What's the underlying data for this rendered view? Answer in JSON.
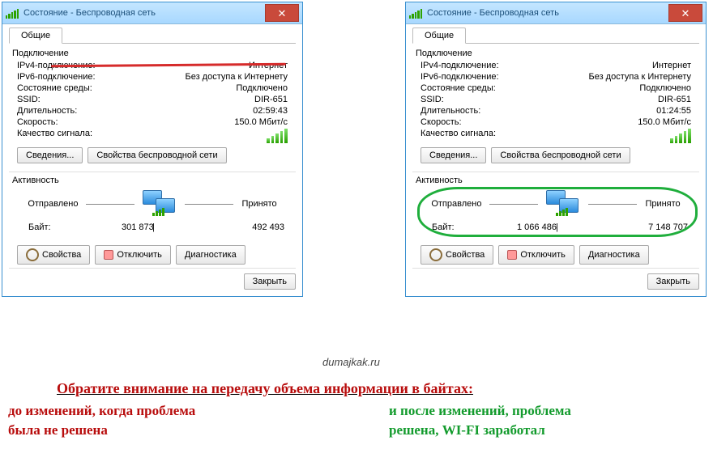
{
  "left": {
    "title": "Состояние - Беспроводная сеть",
    "tab": "Общие",
    "conn_hd": "Подключение",
    "rows": {
      "ipv4_k": "IPv4-подключение:",
      "ipv4_v": "Интернет",
      "ipv6_k": "IPv6-подключение:",
      "ipv6_v": "Без доступа к Интернету",
      "env_k": "Состояние среды:",
      "env_v": "Подключено",
      "ssid_k": "SSID:",
      "ssid_v": "DIR-651",
      "dur_k": "Длительность:",
      "dur_v": "02:59:43",
      "spd_k": "Скорость:",
      "spd_v": "150.0 Мбит/с",
      "qual_k": "Качество сигнала:"
    },
    "btn_details": "Сведения...",
    "btn_wprops": "Свойства беспроводной сети",
    "act_hd": "Активность",
    "sent": "Отправлено",
    "recv": "Принято",
    "bytes_k": "Байт:",
    "bytes_sent": "301 873",
    "bytes_recv": "492 493",
    "btn_props": "Свойства",
    "btn_disc": "Отключить",
    "btn_diag": "Диагностика",
    "btn_close": "Закрыть"
  },
  "right": {
    "title": "Состояние - Беспроводная сеть",
    "tab": "Общие",
    "conn_hd": "Подключение",
    "rows": {
      "ipv4_k": "IPv4-подключение:",
      "ipv4_v": "Интернет",
      "ipv6_k": "IPv6-подключение:",
      "ipv6_v": "Без доступа к Интернету",
      "env_k": "Состояние среды:",
      "env_v": "Подключено",
      "ssid_k": "SSID:",
      "ssid_v": "DIR-651",
      "dur_k": "Длительность:",
      "dur_v": "01:24:55",
      "spd_k": "Скорость:",
      "spd_v": "150.0 Мбит/с",
      "qual_k": "Качество сигнала:"
    },
    "btn_details": "Сведения...",
    "btn_wprops": "Свойства беспроводной сети",
    "act_hd": "Активность",
    "sent": "Отправлено",
    "recv": "Принято",
    "bytes_k": "Байт:",
    "bytes_sent": "1 066 486",
    "bytes_recv": "7 148 707",
    "btn_props": "Свойства",
    "btn_disc": "Отключить",
    "btn_diag": "Диагностика",
    "btn_close": "Закрыть"
  },
  "watermark": "dumajkak.ru",
  "caption_main": "Обратите внимание на передачу объема информации в байтах:",
  "caption_left1": "до изменений, когда проблема",
  "caption_left2": "была не решена",
  "caption_right1": "и после изменений, проблема",
  "caption_right2": "решена, WI-FI заработал"
}
